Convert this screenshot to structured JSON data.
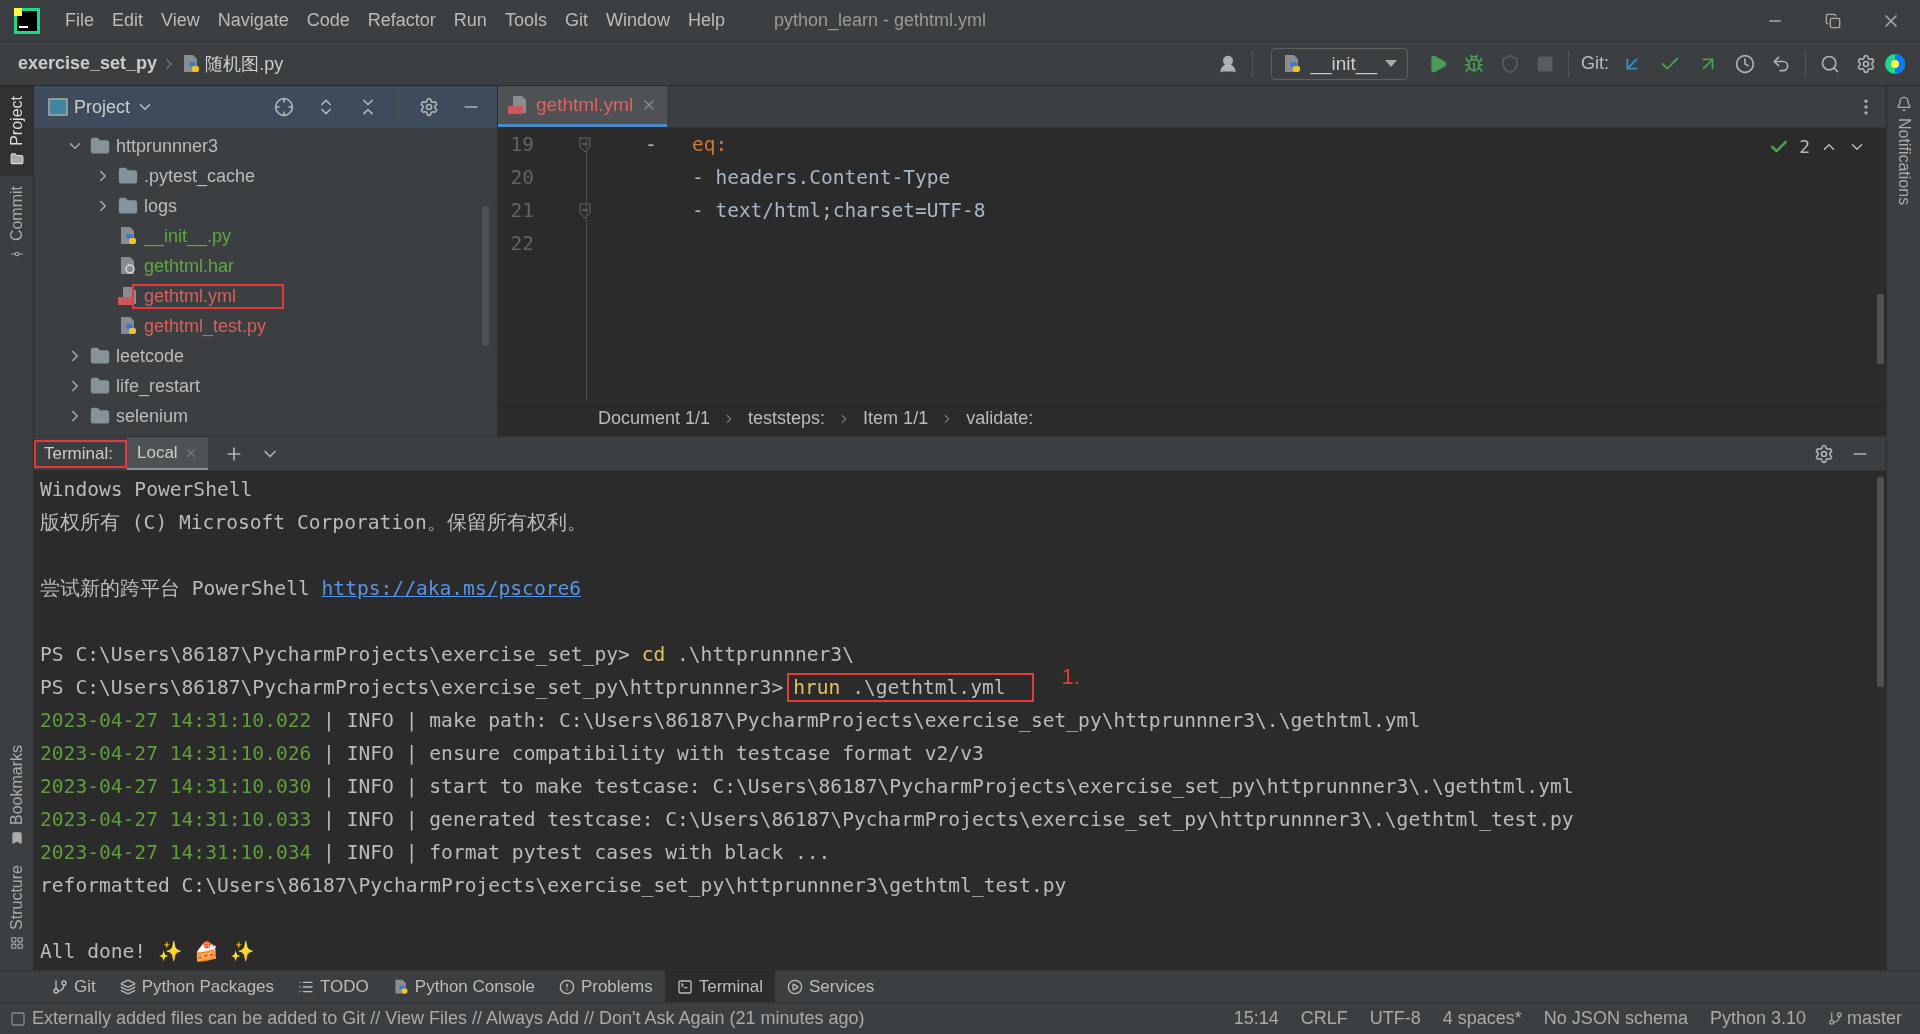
{
  "window": {
    "title": "python_learn - gethtml.yml"
  },
  "menu": [
    {
      "label": "File"
    },
    {
      "label": "Edit"
    },
    {
      "label": "View"
    },
    {
      "label": "Navigate"
    },
    {
      "label": "Code"
    },
    {
      "label": "Refactor"
    },
    {
      "label": "Run"
    },
    {
      "label": "Tools"
    },
    {
      "label": "Git"
    },
    {
      "label": "Window"
    },
    {
      "label": "Help"
    }
  ],
  "nav": [
    {
      "label": "exercise_set_py",
      "kind": "folder"
    },
    {
      "label": "随机图.py",
      "kind": "python"
    }
  ],
  "toolbar": {
    "run_config": "__init__",
    "git_label": "Git:"
  },
  "left_strip": {
    "top": [
      {
        "label": "Project",
        "selected": true
      },
      {
        "label": "Commit",
        "selected": false
      }
    ],
    "bottom": [
      {
        "label": "Bookmarks",
        "selected": false
      },
      {
        "label": "Structure",
        "selected": false
      }
    ]
  },
  "right_strip": [
    {
      "label": "Notifications",
      "selected": false
    }
  ],
  "project": {
    "title": "Project",
    "tree": [
      {
        "label": "httprunnner3",
        "kind": "folder",
        "color": "#bbbbbb",
        "expanded": true,
        "children": [
          {
            "label": ".pytest_cache",
            "kind": "folder",
            "color": "#bbbbbb",
            "expanded": false
          },
          {
            "label": "logs",
            "kind": "folder",
            "color": "#bbbbbb",
            "expanded": false
          },
          {
            "label": "__init__.py",
            "kind": "python",
            "color": "#62a744"
          },
          {
            "label": "gethtml.har",
            "kind": "har",
            "color": "#62a744"
          },
          {
            "label": "gethtml.yml",
            "kind": "yaml",
            "color": "#d9605c",
            "highlighted": true
          },
          {
            "label": "gethtml_test.py",
            "kind": "python",
            "color": "#d9605c"
          }
        ]
      },
      {
        "label": "leetcode",
        "kind": "folder",
        "color": "#bbbbbb",
        "expanded": false
      },
      {
        "label": "life_restart",
        "kind": "folder",
        "color": "#bbbbbb",
        "expanded": false
      },
      {
        "label": "selenium",
        "kind": "folder",
        "color": "#bbbbbb",
        "expanded": false
      }
    ]
  },
  "editor": {
    "tabs": [
      {
        "label": "gethtml.yml",
        "selected": true
      }
    ],
    "inspection_count": "2",
    "lines": [
      {
        "number": "19",
        "fold": true,
        "segments": [
          {
            "text": "    -   ",
            "kind": "plain"
          },
          {
            "text": "eq:",
            "kind": "key"
          }
        ]
      },
      {
        "number": "20",
        "fold": false,
        "segments": [
          {
            "text": "        - headers.Content-Type",
            "kind": "plain"
          }
        ]
      },
      {
        "number": "21",
        "fold": true,
        "segments": [
          {
            "text": "        - text/html;charset=UTF-8",
            "kind": "plain"
          }
        ]
      },
      {
        "number": "22",
        "fold": false
      }
    ],
    "breadcrumbs": [
      "Document 1/1",
      "teststeps:",
      "Item 1/1",
      "validate:"
    ]
  },
  "terminal": {
    "title": "Terminal:",
    "title_highlighted": true,
    "tabs": [
      {
        "label": "Local",
        "selected": true
      }
    ],
    "lines": [
      {
        "kind": "text",
        "segments": [
          {
            "text": "Windows PowerShell",
            "kind": "plain"
          }
        ]
      },
      {
        "kind": "text",
        "segments": [
          {
            "text": "版权所有 (C) Microsoft Corporation。保留所有权利。",
            "kind": "plain"
          }
        ]
      },
      {
        "kind": "blank"
      },
      {
        "kind": "text",
        "segments": [
          {
            "text": "尝试新的跨平台 PowerShell ",
            "kind": "plain"
          },
          {
            "text": "https://aka.ms/pscore6",
            "kind": "link"
          }
        ]
      },
      {
        "kind": "blank"
      },
      {
        "kind": "text",
        "segments": [
          {
            "text": "PS C:\\Users\\86187\\PycharmProjects\\exercise_set_py> ",
            "kind": "plain"
          },
          {
            "text": "cd",
            "kind": "command"
          },
          {
            "text": " .\\httprunnner3\\",
            "kind": "plain"
          }
        ]
      },
      {
        "kind": "text",
        "annotation": "1.",
        "segments": [
          {
            "text": "PS C:\\Users\\86187\\PycharmProjects\\exercise_set_py\\httprunnner3>",
            "kind": "plain"
          },
          {
            "text": "hrun",
            "kind": "command",
            "boxed": true
          },
          {
            "text": " .\\gethtml.yml",
            "kind": "plain",
            "boxed": true
          }
        ]
      },
      {
        "kind": "text",
        "segments": [
          {
            "text": "2023-04-27 14:31:10.022",
            "kind": "timestamp"
          },
          {
            "text": " | INFO | make path: C:\\Users\\86187\\PycharmProjects\\exercise_set_py\\httprunnner3\\.\\gethtml.yml",
            "kind": "plain"
          }
        ]
      },
      {
        "kind": "text",
        "segments": [
          {
            "text": "2023-04-27 14:31:10.026",
            "kind": "timestamp"
          },
          {
            "text": " | INFO | ensure compatibility with testcase format v2/v3",
            "kind": "plain"
          }
        ]
      },
      {
        "kind": "text",
        "segments": [
          {
            "text": "2023-04-27 14:31:10.030",
            "kind": "timestamp"
          },
          {
            "text": " | INFO | start to make testcase: C:\\Users\\86187\\PycharmProjects\\exercise_set_py\\httprunnner3\\.\\gethtml.yml",
            "kind": "plain"
          }
        ]
      },
      {
        "kind": "text",
        "segments": [
          {
            "text": "2023-04-27 14:31:10.033",
            "kind": "timestamp"
          },
          {
            "text": " | INFO | generated testcase: C:\\Users\\86187\\PycharmProjects\\exercise_set_py\\httprunnner3\\.\\gethtml_test.py",
            "kind": "plain"
          }
        ]
      },
      {
        "kind": "text",
        "segments": [
          {
            "text": "2023-04-27 14:31:10.034",
            "kind": "timestamp"
          },
          {
            "text": " | INFO | format pytest cases with black ...",
            "kind": "plain"
          }
        ]
      },
      {
        "kind": "text",
        "segments": [
          {
            "text": "reformatted C:\\Users\\86187\\PycharmProjects\\exercise_set_py\\httprunnner3\\gethtml_test.py",
            "kind": "plain"
          }
        ]
      },
      {
        "kind": "blank"
      },
      {
        "kind": "text",
        "segments": [
          {
            "text": "All done! ✨ 🍰 ✨",
            "kind": "plain"
          }
        ]
      }
    ]
  },
  "tool_tabs": [
    {
      "label": "Git",
      "kind": "git",
      "selected": false
    },
    {
      "label": "Python Packages",
      "kind": "packages",
      "selected": false
    },
    {
      "label": "TODO",
      "kind": "todo",
      "selected": false
    },
    {
      "label": "Python Console",
      "kind": "console",
      "selected": false
    },
    {
      "label": "Problems",
      "kind": "problems",
      "selected": false
    },
    {
      "label": "Terminal",
      "kind": "terminal",
      "selected": true
    },
    {
      "label": "Services",
      "kind": "services",
      "selected": false
    }
  ],
  "status_bar": {
    "message": "Externally added files can be added to Git // View Files // Always Add // Don't Ask Again (21 minutes ago)",
    "items": [
      {
        "label": "15:14",
        "kind": "text"
      },
      {
        "label": "CRLF",
        "kind": "text"
      },
      {
        "label": "UTF-8",
        "kind": "text"
      },
      {
        "label": "4 spaces*",
        "kind": "text"
      },
      {
        "label": "No JSON schema",
        "kind": "text"
      },
      {
        "label": "Python 3.10",
        "kind": "text"
      },
      {
        "label": "master",
        "kind": "branch"
      }
    ]
  }
}
